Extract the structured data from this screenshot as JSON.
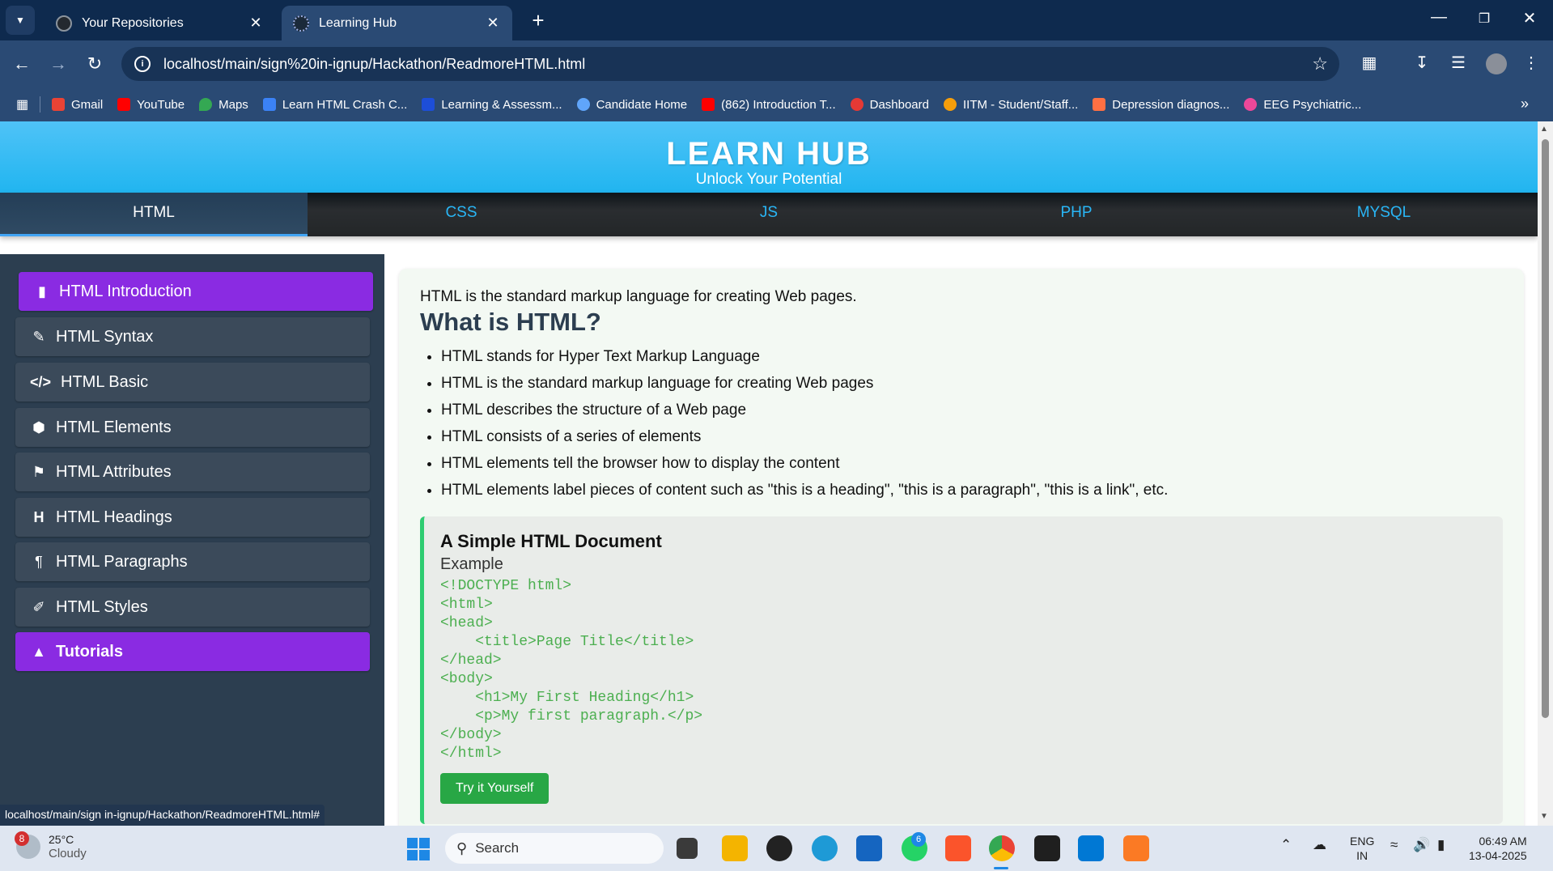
{
  "browser": {
    "tabs": [
      {
        "title": "Your Repositories",
        "active": false
      },
      {
        "title": "Learning Hub",
        "active": true
      }
    ],
    "url": "localhost/main/sign%20in-ignup/Hackathon/ReadmoreHTML.html",
    "bookmarks": [
      {
        "label": "Gmail",
        "color": "#ea4335"
      },
      {
        "label": "YouTube",
        "color": "#ff0000"
      },
      {
        "label": "Maps",
        "color": "#34a853"
      },
      {
        "label": "Learn HTML Crash C...",
        "color": "#3b82f6"
      },
      {
        "label": "Learning & Assessm...",
        "color": "#1d4ed8"
      },
      {
        "label": "Candidate Home",
        "color": "#60a5fa"
      },
      {
        "label": "(862) Introduction T...",
        "color": "#ff0000"
      },
      {
        "label": "Dashboard",
        "color": "#e53935"
      },
      {
        "label": "IITM - Student/Staff...",
        "color": "#f59e0b"
      },
      {
        "label": "Depression diagnos...",
        "color": "#ff7043"
      },
      {
        "label": "EEG Psychiatric...",
        "color": "#ec4899"
      }
    ]
  },
  "site": {
    "title": "LEARN HUB",
    "subtitle": "Unlock Your Potential",
    "nav": [
      {
        "label": "HTML",
        "active": true
      },
      {
        "label": "CSS",
        "active": false
      },
      {
        "label": "JS",
        "active": false
      },
      {
        "label": "PHP",
        "active": false
      },
      {
        "label": "MYSQL",
        "active": false
      }
    ]
  },
  "sidebar": {
    "items": [
      {
        "label": "HTML Introduction",
        "icon": "book-icon"
      },
      {
        "label": "HTML Syntax",
        "icon": "edit-icon"
      },
      {
        "label": "HTML Basic",
        "icon": "code-icon"
      },
      {
        "label": "HTML Elements",
        "icon": "cube-icon"
      },
      {
        "label": "HTML Attributes",
        "icon": "tag-icon"
      },
      {
        "label": "HTML Headings",
        "icon": "heading-icon"
      },
      {
        "label": "HTML Paragraphs",
        "icon": "paragraph-icon"
      },
      {
        "label": "HTML Styles",
        "icon": "brush-icon"
      },
      {
        "label": "Tutorials",
        "icon": "graduation-cap-icon"
      }
    ]
  },
  "content": {
    "intro": "HTML is the standard markup language for creating Web pages.",
    "heading": "What is HTML?",
    "bullets": [
      "HTML stands for Hyper Text Markup Language",
      "HTML is the standard markup language for creating Web pages",
      "HTML describes the structure of a Web page",
      "HTML consists of a series of elements",
      "HTML elements tell the browser how to display the content",
      "HTML elements label pieces of content such as \"this is a heading\", \"this is a paragraph\", \"this is a link\", etc."
    ],
    "example": {
      "title": "A Simple HTML Document",
      "label": "Example",
      "code": "<!DOCTYPE html>\n<html>\n<head>\n    <title>Page Title</title>\n</head>\n<body>\n    <h1>My First Heading</h1>\n    <p>My first paragraph.</p>\n</body>\n</html>",
      "button": "Try it Yourself"
    }
  },
  "status_url": "localhost/main/sign in-ignup/Hackathon/ReadmoreHTML.html#",
  "taskbar": {
    "weather_badge": "8",
    "temperature": "25°C",
    "condition": "Cloudy",
    "search_placeholder": "Search",
    "whatsapp_badge": "6",
    "lang_top": "ENG",
    "lang_bottom": "IN",
    "time": "06:49 AM",
    "date": "13-04-2025"
  }
}
